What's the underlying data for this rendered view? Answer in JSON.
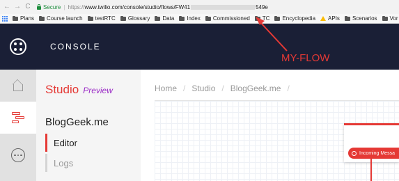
{
  "browser": {
    "nav_back": "←",
    "nav_forward": "→",
    "nav_reload": "C",
    "secure_label": "Secure",
    "url_prefix": "https://",
    "url_main": "www.twilio.com/console/studio/flows/FW41",
    "url_suffix": "549e"
  },
  "bookmarks": [
    {
      "label": "Plans",
      "icon": "folder-icon"
    },
    {
      "label": "Course launch",
      "icon": "folder-icon"
    },
    {
      "label": "testRTC",
      "icon": "folder-icon"
    },
    {
      "label": "Glossary",
      "icon": "folder-icon"
    },
    {
      "label": "Data",
      "icon": "folder-icon"
    },
    {
      "label": "Index",
      "icon": "folder-icon"
    },
    {
      "label": "Commissioned",
      "icon": "folder-icon"
    },
    {
      "label": "TC",
      "icon": "folder-icon"
    },
    {
      "label": "Encyclopedia",
      "icon": "folder-icon"
    },
    {
      "label": "APIs",
      "icon": "drive-icon"
    },
    {
      "label": "Scenarios",
      "icon": "folder-icon"
    },
    {
      "label": "Vor",
      "icon": "folder-icon"
    }
  ],
  "header": {
    "title": "CONSOLE"
  },
  "annotation": {
    "label": "MY-FLOW",
    "color": "#e53935"
  },
  "sidebar": {
    "product": "Studio",
    "badge": "Preview",
    "flow_name": "BlogGeek.me",
    "links": [
      {
        "label": "Editor",
        "active": true
      },
      {
        "label": "Logs",
        "active": false
      }
    ]
  },
  "breadcrumb": [
    "Home",
    "Studio",
    "BlogGeek.me"
  ],
  "canvas": {
    "trigger_label": "Incoming Messa"
  },
  "colors": {
    "accent": "#e53935",
    "header_bg": "#1a1f36",
    "preview": "#9b2dc6"
  }
}
